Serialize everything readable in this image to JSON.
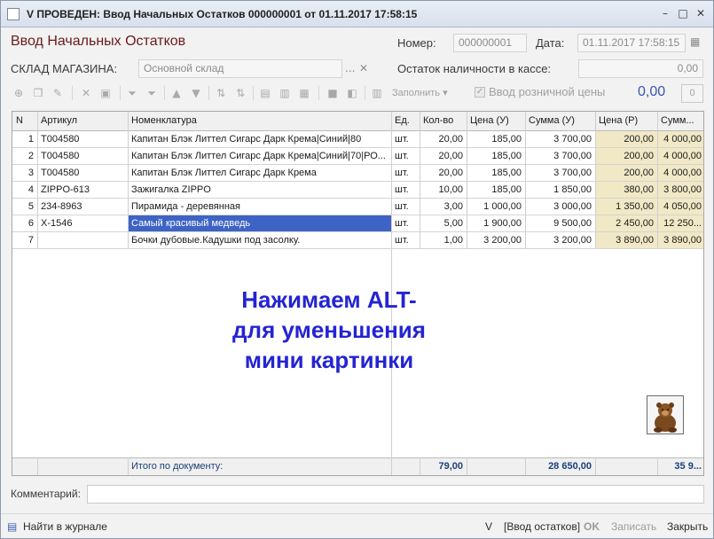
{
  "window": {
    "title": "V ПРОВЕДЕН: Ввод Начальных Остатков 000000001 от 01.11.2017 17:58:15",
    "minimize": "–",
    "maximize": "□",
    "close": "✕"
  },
  "header": {
    "form_title": "Ввод Начальных Остатков",
    "number_label": "Номер:",
    "number_value": "000000001",
    "date_label": "Дата:",
    "date_value": "01.11.2017 17:58:15",
    "date_button": "▦",
    "warehouse_label": "СКЛАД МАГАЗИНА:",
    "warehouse_value": "Основной склад",
    "warehouse_select": "...",
    "warehouse_clear": "✕",
    "cash_label": "Остаток наличности в кассе:",
    "cash_value": "0,00"
  },
  "toolbar": {
    "fill_label": "Заполнить",
    "fill_arrow": "▾",
    "retail_checkbox_label": "Ввод розничной цены",
    "retail_checked": true,
    "total_value": "0,00",
    "small_button": "0",
    "icons": [
      "add-icon",
      "copy-icon",
      "edit-icon",
      "delete-icon",
      "mark-delete-icon",
      "filter-icon",
      "clear-filter-icon",
      "move-up-icon",
      "move-down-icon",
      "sort-asc-icon",
      "sort-desc-icon",
      "pick-icon",
      "group-icon",
      "report-icon",
      "save-icon",
      "layout-icon",
      "barcode-icon"
    ]
  },
  "table": {
    "columns": [
      "N",
      "Артикул",
      "Номенклатура",
      "Ед.",
      "Кол-во",
      "Цена (У)",
      "Сумма (У)",
      "Цена (Р)",
      "Сумм..."
    ],
    "rows": [
      [
        "1",
        "T004580",
        "Капитан Блэк Литтел Сигарс Дарк Крема|Синий|80",
        "шт.",
        "20,00",
        "185,00",
        "3 700,00",
        "200,00",
        "4 000,00"
      ],
      [
        "2",
        "T004580",
        "Капитан Блэк Литтел Сигарс Дарк Крема|Синий|70|РО...",
        "шт.",
        "20,00",
        "185,00",
        "3 700,00",
        "200,00",
        "4 000,00"
      ],
      [
        "3",
        "T004580",
        "Капитан Блэк Литтел Сигарс Дарк Крема",
        "шт.",
        "20,00",
        "185,00",
        "3 700,00",
        "200,00",
        "4 000,00"
      ],
      [
        "4",
        "ZIPPO-613",
        "Зажигалка ZIPPO",
        "шт.",
        "10,00",
        "185,00",
        "1 850,00",
        "380,00",
        "3 800,00"
      ],
      [
        "5",
        "234-8963",
        "Пирамида - деревянная",
        "шт.",
        "3,00",
        "1 000,00",
        "3 000,00",
        "1 350,00",
        "4 050,00"
      ],
      [
        "6",
        "X-1546",
        "Самый красивый медведь",
        "шт.",
        "5,00",
        "1 900,00",
        "9 500,00",
        "2 450,00",
        "12 250..."
      ],
      [
        "7",
        "",
        "Бочки дубовые.Кадушки под засолку.",
        "шт.",
        "1,00",
        "3 200,00",
        "3 200,00",
        "3 890,00",
        "3 890,00"
      ]
    ],
    "selected_row": 5,
    "footer_label": "Итого по документу:",
    "footer_qty": "79,00",
    "footer_sum": "28 650,00",
    "footer_sum_r": "35 9..."
  },
  "overlay_text": [
    "Нажимаем ALT-",
    "для уменьшения",
    "мини картинки"
  ],
  "thumbnail_icon": "bear-figurine-icon",
  "comment": {
    "label": "Комментарий:",
    "value": ""
  },
  "statusbar": {
    "journal_label": "Найти в журнале",
    "version": "V",
    "doc_type": "[Ввод остатков]",
    "ok_label": "OK",
    "write_label": "Записать",
    "close_label": "Закрыть"
  },
  "colors": {
    "selection": "#3d64c4",
    "price_r_column": "#f1e8c6",
    "overlay_text": "#2424d2",
    "form_title": "#6b1a1a"
  }
}
